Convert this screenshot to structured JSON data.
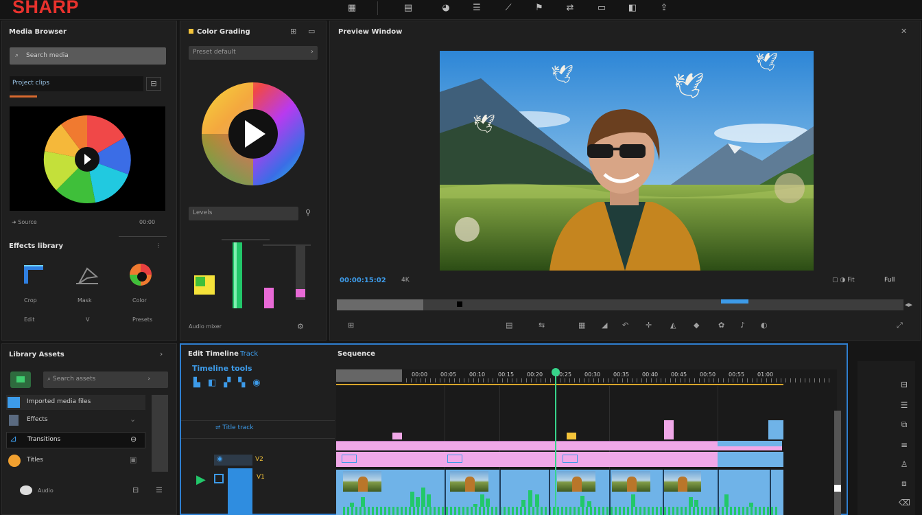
{
  "app": {
    "logo": "SHARP",
    "title_text": "",
    "toolbar_icons": [
      "grid-icon",
      "split-icon",
      "palette-icon",
      "text-icon",
      "wand-icon",
      "flag-icon",
      "share-icon",
      "chat-icon",
      "screen-icon",
      "export-icon"
    ]
  },
  "media_panel": {
    "title": "Media Browser",
    "search_placeholder": "Search media",
    "project_label": "Project clips",
    "footer_left": "Source",
    "footer_right": "00:00",
    "effects_title": "Effects library",
    "effects": [
      {
        "label": "Crop",
        "sub": "Edit"
      },
      {
        "label": "Mask",
        "sub": "V"
      },
      {
        "label": "Color",
        "sub": "Presets"
      }
    ]
  },
  "color_panel": {
    "title": "Color Grading",
    "preset_label": "Preset default",
    "levels_label": "Levels",
    "footer": "Audio mixer"
  },
  "preview": {
    "title": "Preview Window",
    "timecode": "00:00:15:02",
    "zoom": "4K",
    "fit": "Fit",
    "quality": "Full"
  },
  "library_panel": {
    "title": "Library Assets",
    "search_placeholder": "Search assets",
    "items": [
      {
        "label": "Imported media files"
      },
      {
        "label": "Effects"
      },
      {
        "label": "Transitions"
      },
      {
        "label": "Titles"
      }
    ],
    "footer": "Audio"
  },
  "timeline": {
    "title": "Edit Timeline",
    "tab": "Track",
    "sequence_label": "Sequence",
    "toolbar_label": "Timeline tools",
    "ruler": [
      "00:00",
      "00:05",
      "00:10",
      "00:15",
      "00:20",
      "00:25",
      "00:30",
      "00:35",
      "00:40",
      "00:45",
      "00:50",
      "00:55",
      "01:00"
    ],
    "track_labels": [
      "Title track",
      "V2",
      "V1"
    ],
    "playhead": "00:15"
  },
  "colors": {
    "accent": "#3d9be9",
    "logo": "#e8322d",
    "playhead": "#37d48a",
    "clip_pink": "#f0a8e8",
    "clip_blue": "#6fb3e8",
    "audio_green": "#22c76a"
  }
}
